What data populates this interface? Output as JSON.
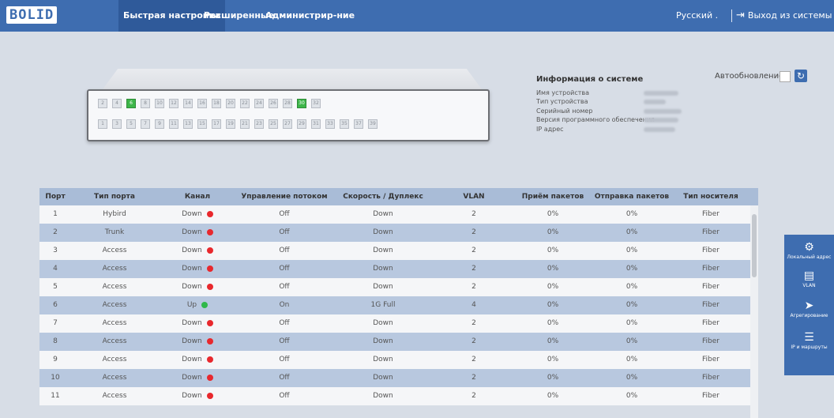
{
  "header": {
    "logo": "BOLID",
    "nav": [
      "Быстрая настройка",
      "Расширенные",
      "Администрир-ние"
    ],
    "language": "Русский .",
    "logout": "Выход из системы"
  },
  "autorefresh_label": "Автообновление:",
  "device_ports": {
    "top": [
      "2",
      "4",
      "6",
      "8",
      "10",
      "12",
      "14",
      "16",
      "18",
      "20",
      "22",
      "24",
      "26",
      "28",
      "30",
      "32"
    ],
    "bottom": [
      "1",
      "3",
      "5",
      "7",
      "9",
      "11",
      "13",
      "15",
      "17",
      "19",
      "21",
      "23",
      "25",
      "27",
      "29",
      "31",
      "33",
      "35",
      "37",
      "39"
    ],
    "up_ports": [
      "6",
      "30"
    ]
  },
  "sysinfo": {
    "title": "Информация о системе",
    "labels": [
      "Имя устройства",
      "Тип устройства",
      "Серийный номер",
      "Версия программного обеспечения",
      "IP адрес"
    ]
  },
  "table": {
    "headers": [
      "Порт",
      "Тип порта",
      "Канал",
      "Управление потоком",
      "Скорость / Дуплекс",
      "VLAN",
      "Приём пакетов",
      "Отправка пакетов",
      "Тип носителя"
    ],
    "rows": [
      {
        "port": "1",
        "type": "Hybird",
        "link": "Down",
        "flow": "Off",
        "speed": "Down",
        "vlan": "2",
        "rx": "0%",
        "tx": "0%",
        "media": "Fiber"
      },
      {
        "port": "2",
        "type": "Trunk",
        "link": "Down",
        "flow": "Off",
        "speed": "Down",
        "vlan": "2",
        "rx": "0%",
        "tx": "0%",
        "media": "Fiber"
      },
      {
        "port": "3",
        "type": "Access",
        "link": "Down",
        "flow": "Off",
        "speed": "Down",
        "vlan": "2",
        "rx": "0%",
        "tx": "0%",
        "media": "Fiber"
      },
      {
        "port": "4",
        "type": "Access",
        "link": "Down",
        "flow": "Off",
        "speed": "Down",
        "vlan": "2",
        "rx": "0%",
        "tx": "0%",
        "media": "Fiber"
      },
      {
        "port": "5",
        "type": "Access",
        "link": "Down",
        "flow": "Off",
        "speed": "Down",
        "vlan": "2",
        "rx": "0%",
        "tx": "0%",
        "media": "Fiber"
      },
      {
        "port": "6",
        "type": "Access",
        "link": "Up",
        "flow": "On",
        "speed": "1G Full",
        "vlan": "4",
        "rx": "0%",
        "tx": "0%",
        "media": "Fiber"
      },
      {
        "port": "7",
        "type": "Access",
        "link": "Down",
        "flow": "Off",
        "speed": "Down",
        "vlan": "2",
        "rx": "0%",
        "tx": "0%",
        "media": "Fiber"
      },
      {
        "port": "8",
        "type": "Access",
        "link": "Down",
        "flow": "Off",
        "speed": "Down",
        "vlan": "2",
        "rx": "0%",
        "tx": "0%",
        "media": "Fiber"
      },
      {
        "port": "9",
        "type": "Access",
        "link": "Down",
        "flow": "Off",
        "speed": "Down",
        "vlan": "2",
        "rx": "0%",
        "tx": "0%",
        "media": "Fiber"
      },
      {
        "port": "10",
        "type": "Access",
        "link": "Down",
        "flow": "Off",
        "speed": "Down",
        "vlan": "2",
        "rx": "0%",
        "tx": "0%",
        "media": "Fiber"
      },
      {
        "port": "11",
        "type": "Access",
        "link": "Down",
        "flow": "Off",
        "speed": "Down",
        "vlan": "2",
        "rx": "0%",
        "tx": "0%",
        "media": "Fiber"
      }
    ]
  },
  "status_colors": {
    "up": "#2fb84a",
    "down": "#e8282d"
  },
  "sidepanel": [
    {
      "icon": "⚙",
      "icon_name": "gear-icon",
      "label": "Локальный адрес"
    },
    {
      "icon": "▤",
      "icon_name": "vlan-icon",
      "label": "VLAN"
    },
    {
      "icon": "➤",
      "icon_name": "aggregation-icon",
      "label": "Агрегирование"
    },
    {
      "icon": "☰",
      "icon_name": "sliders-icon",
      "label": "IP и маршруты"
    }
  ]
}
